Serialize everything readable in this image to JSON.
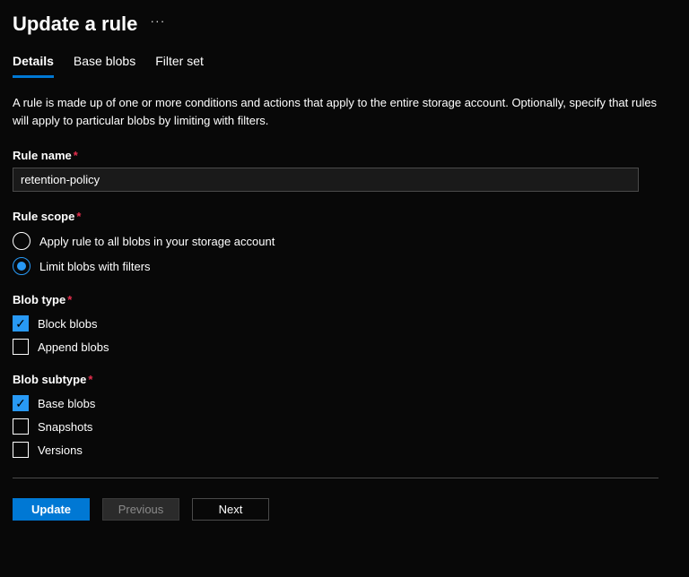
{
  "header": {
    "title": "Update a rule"
  },
  "tabs": [
    {
      "label": "Details",
      "active": true
    },
    {
      "label": "Base blobs",
      "active": false
    },
    {
      "label": "Filter set",
      "active": false
    }
  ],
  "description": "A rule is made up of one or more conditions and actions that apply to the entire storage account. Optionally, specify that rules will apply to particular blobs by limiting with filters.",
  "rule_name": {
    "label": "Rule name",
    "value": "retention-policy"
  },
  "rule_scope": {
    "label": "Rule scope",
    "options": [
      {
        "label": "Apply rule to all blobs in your storage account",
        "selected": false
      },
      {
        "label": "Limit blobs with filters",
        "selected": true
      }
    ]
  },
  "blob_type": {
    "label": "Blob type",
    "options": [
      {
        "label": "Block blobs",
        "checked": true
      },
      {
        "label": "Append blobs",
        "checked": false
      }
    ]
  },
  "blob_subtype": {
    "label": "Blob subtype",
    "options": [
      {
        "label": "Base blobs",
        "checked": true
      },
      {
        "label": "Snapshots",
        "checked": false
      },
      {
        "label": "Versions",
        "checked": false
      }
    ]
  },
  "buttons": {
    "update": "Update",
    "previous": "Previous",
    "next": "Next"
  },
  "required_marker": "*"
}
